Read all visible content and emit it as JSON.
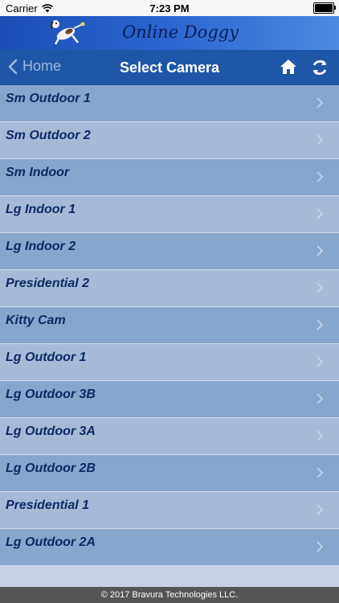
{
  "status_bar": {
    "carrier": "Carrier",
    "time": "7:23 PM",
    "battery_level": 1.0
  },
  "banner": {
    "app_title": "Online Doggy"
  },
  "nav": {
    "back_label": "Home",
    "title": "Select Camera",
    "icons": [
      "chevron-left-icon",
      "home-icon",
      "refresh-icon"
    ]
  },
  "cameras": [
    {
      "label": "Sm Outdoor 1"
    },
    {
      "label": "Sm Outdoor 2"
    },
    {
      "label": "Sm Indoor"
    },
    {
      "label": "Lg Indoor 1"
    },
    {
      "label": "Lg Indoor 2"
    },
    {
      "label": "Presidential 2"
    },
    {
      "label": "Kitty Cam"
    },
    {
      "label": "Lg Outdoor 1"
    },
    {
      "label": "Lg Outdoor 3B"
    },
    {
      "label": "Lg Outdoor 3A"
    },
    {
      "label": "Lg Outdoor 2B"
    },
    {
      "label": "Presidential 1"
    },
    {
      "label": "Lg Outdoor 2A"
    }
  ],
  "footer": {
    "copyright": "© 2017 Bravura Technologies LLC."
  },
  "colors": {
    "banner_blue": "#2a66cf",
    "nav_blue": "#1e57a7",
    "row_dark": "#87a5cd",
    "row_light": "#a6b9d5",
    "label_text": "#0c2a66",
    "footer_gray": "#555555"
  }
}
